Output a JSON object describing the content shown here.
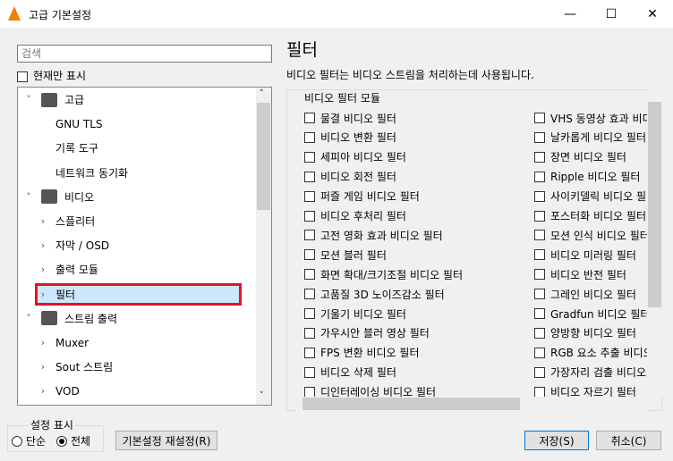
{
  "window": {
    "title": "고급 기본설정",
    "minimize": "—",
    "maximize": "☐",
    "close": "✕"
  },
  "search": {
    "placeholder": "검색"
  },
  "only_current": "현재만 표시",
  "tree": [
    {
      "label": "고급",
      "level": 0,
      "expanded": true,
      "icon": "chip-icon"
    },
    {
      "label": "GNU TLS",
      "level": 1
    },
    {
      "label": "기록 도구",
      "level": 1
    },
    {
      "label": "네트워크 동기화",
      "level": 1
    },
    {
      "label": "비디오",
      "level": 0,
      "expanded": true,
      "icon": "video-icon"
    },
    {
      "label": "스플리터",
      "level": 1,
      "chev": true
    },
    {
      "label": "자막 / OSD",
      "level": 1,
      "chev": true
    },
    {
      "label": "출력 모듈",
      "level": 1,
      "chev": true
    },
    {
      "label": "필터",
      "level": 1,
      "chev": true,
      "selected": true
    },
    {
      "label": "스트림 출력",
      "level": 0,
      "expanded": true,
      "icon": "stream-icon"
    },
    {
      "label": "Muxer",
      "level": 1,
      "chev": true
    },
    {
      "label": "Sout 스트림",
      "level": 1,
      "chev": true
    },
    {
      "label": "VOD",
      "level": 1,
      "chev": true
    }
  ],
  "panel": {
    "title": "필터",
    "description": "비디오 필터는 비디오 스트림을 처리하는데 사용됩니다.",
    "group_label": "비디오 필터 모듈"
  },
  "filters_left": [
    "물결 비디오 필터",
    "비디오 변환 필터",
    "세피아 비디오 필터",
    "비디오 회전 필터",
    "퍼즐 게임 비디오 필터",
    "비디오 후처리 필터",
    "고전 영화 효과 비디오 필터",
    "모션 블러 필터",
    "화면 확대/크기조절 비디오 필터",
    "고품질 3D 노이즈감소 필터",
    "기울기 비디오 필터",
    "가우시안 블러 영상 필터",
    "FPS 변환 비디오 필터",
    "비디오 삭제 필터",
    "디인터레이싱 비디오 필터"
  ],
  "filters_right": [
    "VHS 동영상 효과 비디오 필터",
    "날카롭게 비디오 필터",
    "장면 비디오 필터",
    "Ripple 비디오 필터",
    "사이키델릭 비디오 필터",
    "포스터화 비디오 필터",
    "모션 인식 비디오 필터",
    "비디오 미러링 필터",
    "비디오 반전 필터",
    "그레인 비디오 필터",
    "Gradfun 비디오 필터",
    "양방향 비디오 필터",
    "RGB 요소 추출 비디오 필터",
    "가장자리 검출 비디오 필터",
    "비디오 자르기 필터"
  ],
  "view": {
    "label": "설정 표시",
    "simple": "단순",
    "all": "전체",
    "selected": "all"
  },
  "buttons": {
    "reset": "기본설정 재설정(R)",
    "save": "저장(S)",
    "cancel": "취소(C)"
  }
}
